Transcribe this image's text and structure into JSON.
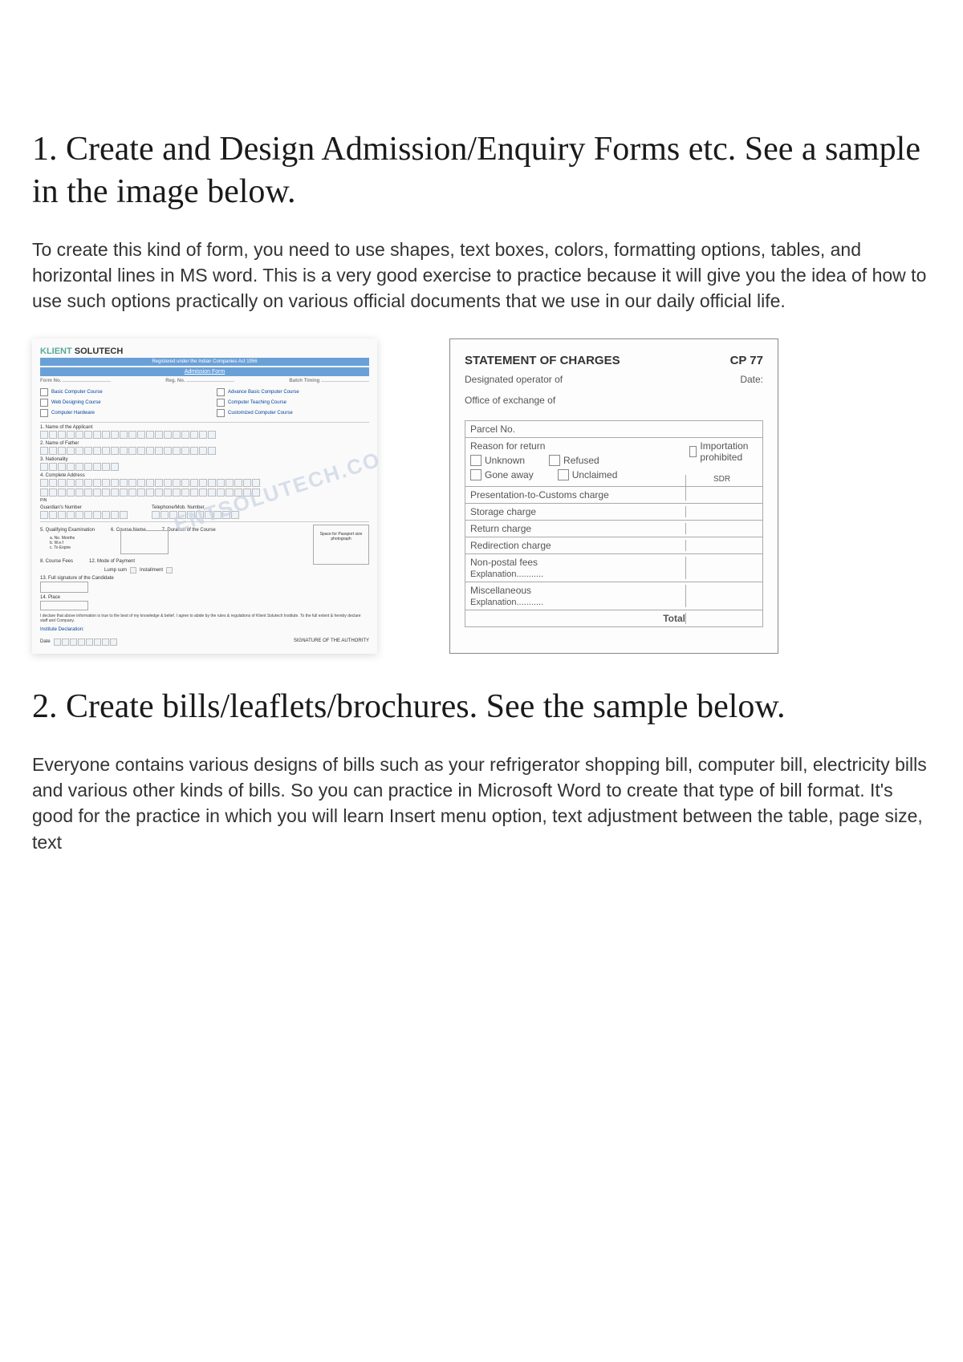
{
  "section1": {
    "heading": "1. Create and Design Admission/Enquiry Forms etc. See a sample in the image below.",
    "paragraph": "To create this kind of form, you need to use shapes, text boxes, colors, formatting options, tables, and horizontal lines in MS word. This is a very good exercise to practice because it will give you the idea of how to use such options practically on various official documents that we use in our daily official life."
  },
  "form_left": {
    "brand_part1": "KLIENT",
    "brand_part2": " SOLUTECH",
    "bluebar1": "Registered under the Indian Companies Act 1956",
    "bluebar2": "Admission Form",
    "top": {
      "formno": "Form No.",
      "regno": "Reg. No.",
      "batch": "Batch Timing"
    },
    "courses_left": [
      "Basic Computer Course",
      "Web Designing Course",
      "Computer Hardware"
    ],
    "courses_right": [
      "Advance Basic Computer Course",
      "Computer Teaching Course",
      "Customized Computer Course"
    ],
    "labels": {
      "name": "1. Name of the Applicant",
      "father": "2. Name of Father",
      "nationality": "3. Nationality",
      "address": "4. Complete Address",
      "guardian": "Guardian's Number",
      "telephone": "Telephone/Mob. Number",
      "qualifying": "5. Qualifying Examination",
      "coursename": "6. Course Name",
      "duration": "7. Duration of the Course",
      "a": "a. No. Months",
      "b": "b. W.e.f",
      "c": "c. To Expire",
      "coursefees": "8. Course Fees",
      "installment": "12. Mode of Payment",
      "lumpsum": "Lump sum",
      "installment2": "Installment",
      "signature": "13. Full signature of the Candidate",
      "place": "14. Place",
      "passport": "Space for Passport size photograph",
      "declare": "I declare that above information is true to the best of my knowledge & belief. I agree to abide by the rules & regulations of Klient Solutech Institute. To the full extent & hereby declare staff and Company.",
      "inst": "Institute Declaration:",
      "date": "Date",
      "sig_auth": "SIGNATURE OF THE AUTHORITY"
    },
    "watermark": "ENTSOLUTECH.CO"
  },
  "form_right": {
    "title": "STATEMENT OF CHARGES",
    "code": "CP 77",
    "operator": "Designated operator of",
    "date": "Date:",
    "office": "Office of exchange of",
    "rows": {
      "parcel": "Parcel No.",
      "reason": "Reason for return",
      "unknown": "Unknown",
      "refused": "Refused",
      "goneaway": "Gone away",
      "unclaimed": "Unclaimed",
      "importation": "Importation prohibited",
      "sdr": "SDR",
      "presentation": "Presentation-to-Customs charge",
      "storage": "Storage charge",
      "return": "Return charge",
      "redirection": "Redirection charge",
      "nonpostal": "Non-postal fees",
      "expl1": "Explanation...........",
      "misc": "Miscellaneous",
      "expl2": "Explanation...........",
      "total": "Total"
    }
  },
  "section2": {
    "heading": "2. Create bills/leaflets/brochures. See the sample below.",
    "paragraph": "Everyone contains various designs of bills such as your refrigerator shopping bill, computer bill, electricity bills and various other kinds of bills. So you can practice in Microsoft Word to create that type of bill format. It's good for the practice in which you will learn Insert menu option, text adjustment between the table, page size, text"
  }
}
